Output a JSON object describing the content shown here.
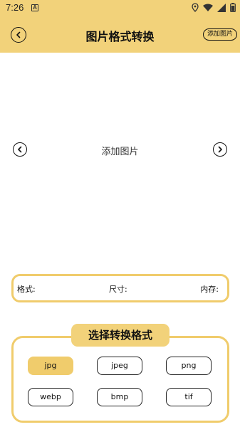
{
  "status_bar": {
    "time": "7:26",
    "notification_icon": "A"
  },
  "header": {
    "title": "图片格式转换",
    "add_button_label": "添加图片"
  },
  "preview": {
    "hint": "添加图片"
  },
  "info": {
    "format_label": "格式:",
    "size_label": "尺寸:",
    "memory_label": "内存:"
  },
  "format_section": {
    "title": "选择转换格式",
    "options": [
      "jpg",
      "jpeg",
      "png",
      "webp",
      "bmp",
      "tif"
    ],
    "selected": "jpg"
  },
  "colors": {
    "accent": "#f2d27a",
    "border_accent": "#f0cc6c"
  }
}
